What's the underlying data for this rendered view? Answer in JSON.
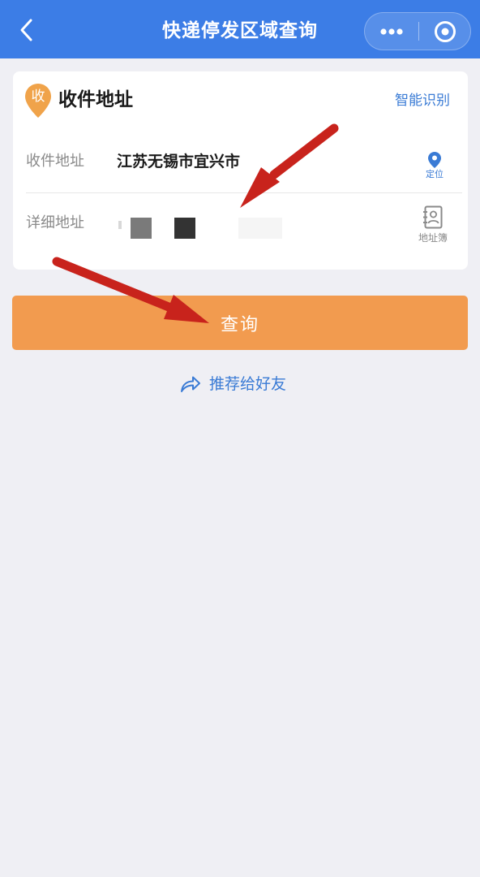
{
  "navbar": {
    "title": "快递停发区域查询",
    "back_icon": "chevron-left-icon",
    "more_icon": "more-dots-icon",
    "close_icon": "mini-program-close-icon",
    "background_color": "#3c7de6"
  },
  "card": {
    "pin_icon": "location-pin-icon",
    "pin_text": "收",
    "pin_color": "#f0a34a",
    "title": "收件地址",
    "smart_recognize_label": "智能识别",
    "address_row": {
      "label": "收件地址",
      "value": "江苏无锡市宜兴市",
      "locate_icon": "location-icon",
      "locate_label": "定位"
    },
    "detail_row": {
      "label": "详细地址",
      "addressbook_icon": "address-book-icon",
      "addressbook_label": "地址簿"
    }
  },
  "query_button": {
    "label": "查询",
    "color": "#f29b4f"
  },
  "share": {
    "icon": "share-icon",
    "label": "推荐给好友"
  },
  "annotations": {
    "arrow_color": "#c8231c"
  }
}
